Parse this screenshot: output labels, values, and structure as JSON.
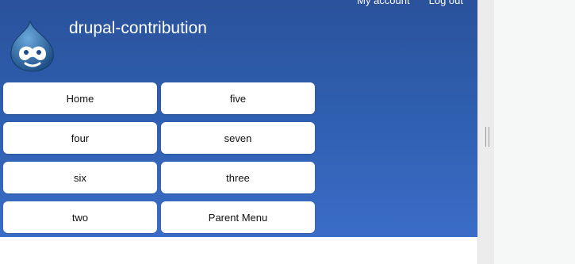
{
  "site": {
    "name": "drupal-contribution"
  },
  "secondary_menu": {
    "my_account": "My account",
    "log_out": "Log out"
  },
  "main_menu": [
    {
      "label": "Home"
    },
    {
      "label": "five"
    },
    {
      "label": "four"
    },
    {
      "label": "seven"
    },
    {
      "label": "six"
    },
    {
      "label": "three"
    },
    {
      "label": "two"
    },
    {
      "label": "Parent Menu"
    }
  ],
  "colors": {
    "header_top": "#2a529b",
    "header_bottom": "#3a6dc8",
    "button_bg": "#ffffff"
  },
  "icons": {
    "logo": "drupal-drop-logo",
    "panel_grip": "resize-grip-icon"
  }
}
